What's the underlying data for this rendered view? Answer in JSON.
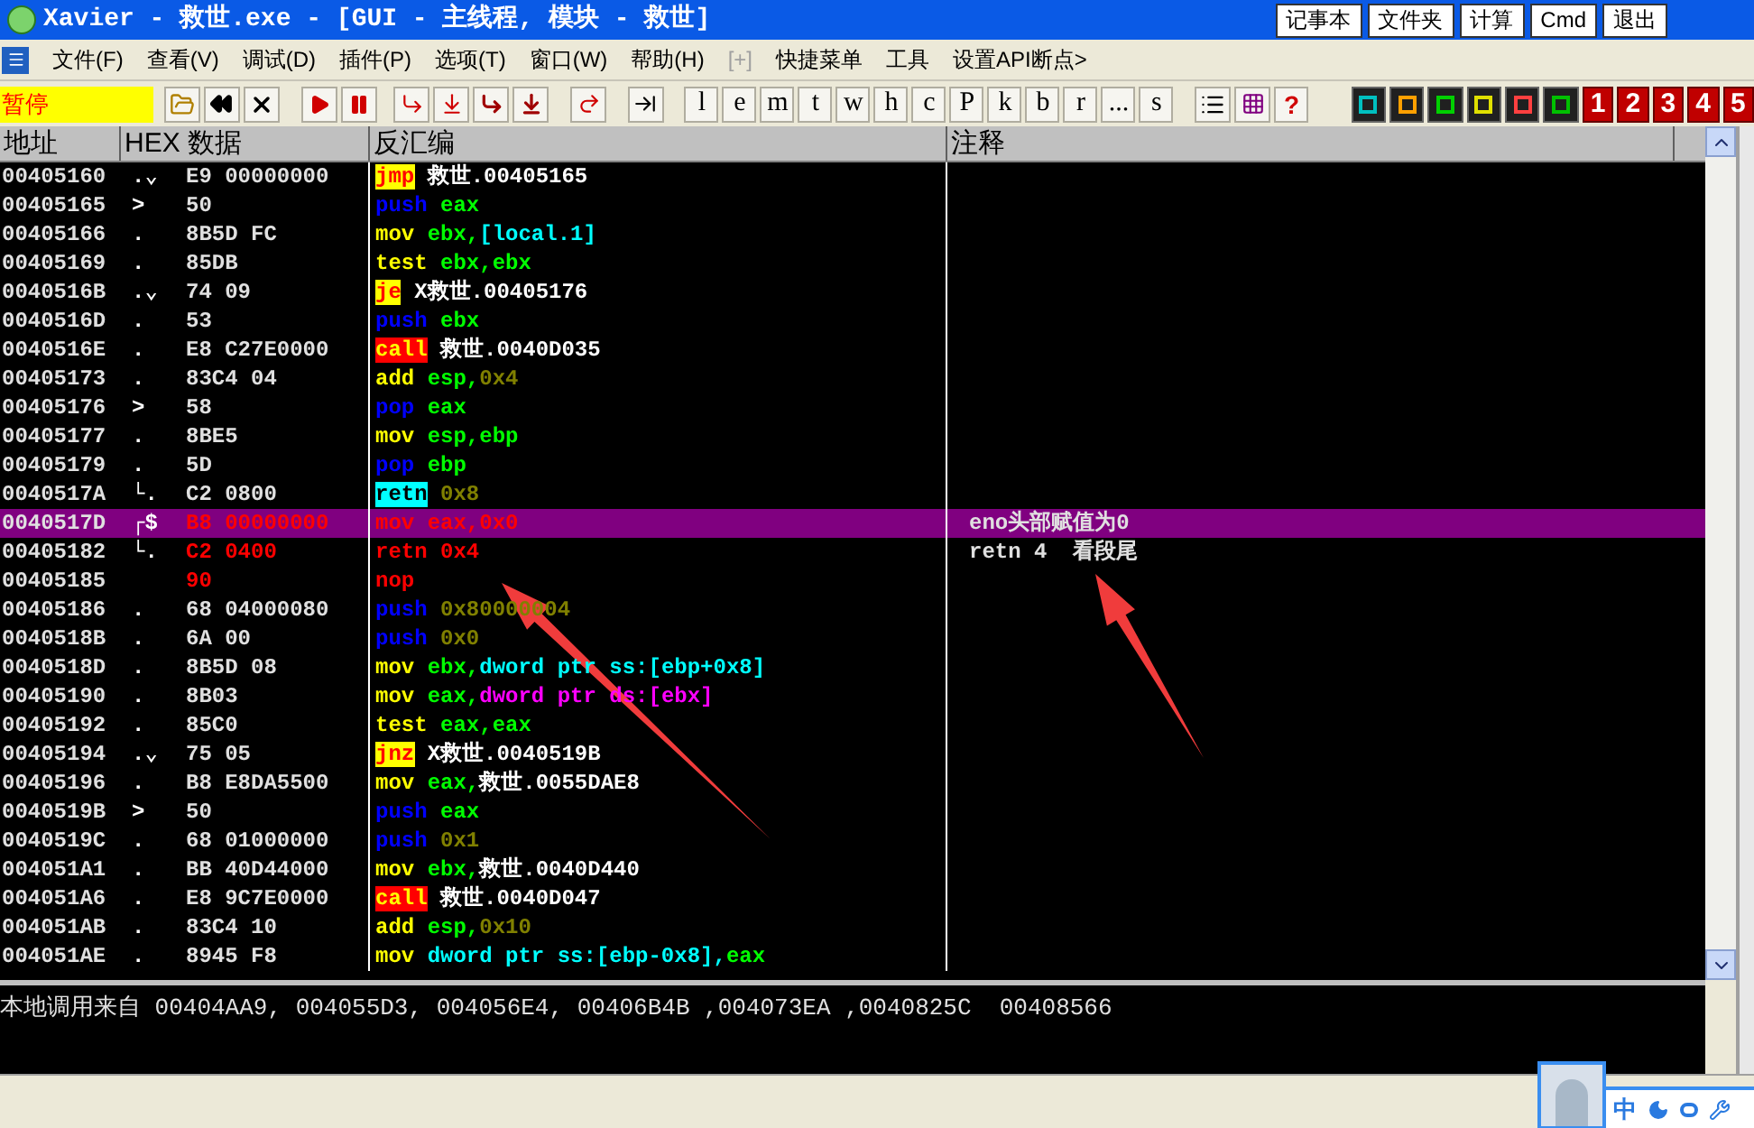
{
  "window": {
    "title": "Xavier - 救世.exe - [GUI -  主线程, 模块 - 救世]"
  },
  "title_buttons": [
    "记事本",
    "文件夹",
    "计算",
    "Cmd",
    "退出"
  ],
  "menu": [
    {
      "label": "文件(F)",
      "disabled": false
    },
    {
      "label": "查看(V)",
      "disabled": false
    },
    {
      "label": "调试(D)",
      "disabled": false
    },
    {
      "label": "插件(P)",
      "disabled": false
    },
    {
      "label": "选项(T)",
      "disabled": false
    },
    {
      "label": "窗口(W)",
      "disabled": false
    },
    {
      "label": "帮助(H)",
      "disabled": false
    },
    {
      "label": "[+]",
      "disabled": true
    },
    {
      "label": "快捷菜单",
      "disabled": false
    },
    {
      "label": "工具",
      "disabled": false
    },
    {
      "label": "设置API断点>",
      "disabled": false
    }
  ],
  "status": "暂停",
  "letter_buttons": [
    "l",
    "e",
    "m",
    "t",
    "w",
    "h",
    "c",
    "P",
    "k",
    "b",
    "r",
    "...",
    "s"
  ],
  "help_button": "?",
  "number_buttons": [
    "1",
    "2",
    "3",
    "4",
    "5"
  ],
  "columns": [
    "地址",
    "HEX 数据",
    "反汇编",
    "注释"
  ],
  "rows": [
    {
      "address": "00405160",
      "flow": ".⌄",
      "hex": "E9 00000000",
      "disasm": [
        {
          "text": "jmp",
          "kind": "jump"
        },
        {
          "text": "救世.00405165",
          "kind": "label"
        }
      ],
      "selected": false,
      "modified": false
    },
    {
      "address": "00405165",
      "flow": ">",
      "hex": "50",
      "disasm": [
        {
          "text": "push",
          "kind": "push"
        },
        {
          "text": "eax",
          "kind": "reg"
        }
      ],
      "selected": false,
      "modified": false
    },
    {
      "address": "00405166",
      "flow": ".",
      "hex": "8B5D FC",
      "disasm": [
        {
          "text": "mov",
          "kind": "op"
        },
        {
          "text": "ebx,",
          "kind": "reg"
        },
        {
          "text": "[local.1]",
          "kind": "mem"
        }
      ],
      "selected": false,
      "modified": false
    },
    {
      "address": "00405169",
      "flow": ".",
      "hex": "85DB",
      "disasm": [
        {
          "text": "test",
          "kind": "op"
        },
        {
          "text": "ebx,ebx",
          "kind": "reg"
        }
      ],
      "selected": false,
      "modified": false
    },
    {
      "address": "0040516B",
      "flow": ".⌄",
      "hex": "74 09",
      "disasm": [
        {
          "text": "je",
          "kind": "jump"
        },
        {
          "text": "X救世.00405176",
          "kind": "label"
        }
      ],
      "selected": false,
      "modified": false
    },
    {
      "address": "0040516D",
      "flow": ".",
      "hex": "53",
      "disasm": [
        {
          "text": "push",
          "kind": "push"
        },
        {
          "text": "ebx",
          "kind": "reg"
        }
      ],
      "selected": false,
      "modified": false
    },
    {
      "address": "0040516E",
      "flow": ".",
      "hex": "E8 C27E0000",
      "disasm": [
        {
          "text": "call",
          "kind": "call"
        },
        {
          "text": "救世.0040D035",
          "kind": "label"
        }
      ],
      "selected": false,
      "modified": false
    },
    {
      "address": "00405173",
      "flow": ".",
      "hex": "83C4 04",
      "disasm": [
        {
          "text": "add",
          "kind": "op"
        },
        {
          "text": "esp,",
          "kind": "reg"
        },
        {
          "text": "0x4",
          "kind": "const"
        }
      ],
      "selected": false,
      "modified": false
    },
    {
      "address": "00405176",
      "flow": ">",
      "hex": "58",
      "disasm": [
        {
          "text": "pop",
          "kind": "push"
        },
        {
          "text": "eax",
          "kind": "reg"
        }
      ],
      "selected": false,
      "modified": false
    },
    {
      "address": "00405177",
      "flow": ".",
      "hex": "8BE5",
      "disasm": [
        {
          "text": "mov",
          "kind": "op"
        },
        {
          "text": "esp,ebp",
          "kind": "reg"
        }
      ],
      "selected": false,
      "modified": false
    },
    {
      "address": "00405179",
      "flow": ".",
      "hex": "5D",
      "disasm": [
        {
          "text": "pop",
          "kind": "push"
        },
        {
          "text": "ebp",
          "kind": "reg"
        }
      ],
      "selected": false,
      "modified": false
    },
    {
      "address": "0040517A",
      "flow": "└.",
      "hex": "C2 0800",
      "disasm": [
        {
          "text": "retn",
          "kind": "ret"
        },
        {
          "text": "0x8",
          "kind": "const"
        }
      ],
      "selected": false,
      "modified": false
    },
    {
      "address": "0040517D",
      "flow": "┌$",
      "hex": "B8 00000000",
      "disasm": [
        {
          "text": "mov",
          "kind": "changed"
        },
        {
          "text": "eax,0x0",
          "kind": "changed"
        }
      ],
      "comment": "eno头部赋值为0",
      "selected": true,
      "modified": true
    },
    {
      "address": "00405182",
      "flow": "└.",
      "hex": "C2 0400",
      "disasm": [
        {
          "text": "retn",
          "kind": "changed"
        },
        {
          "text": "0x4",
          "kind": "changed"
        }
      ],
      "comment": "retn 4  看段尾",
      "selected": false,
      "modified": true
    },
    {
      "address": "00405185",
      "flow": "",
      "hex": "90",
      "disasm": [
        {
          "text": "nop",
          "kind": "changed"
        }
      ],
      "selected": false,
      "modified": true
    },
    {
      "address": "00405186",
      "flow": ".",
      "hex": "68 04000080",
      "disasm": [
        {
          "text": "push",
          "kind": "push"
        },
        {
          "text": "0x80000004",
          "kind": "const"
        }
      ],
      "selected": false,
      "modified": false
    },
    {
      "address": "0040518B",
      "flow": ".",
      "hex": "6A 00",
      "disasm": [
        {
          "text": "push",
          "kind": "push"
        },
        {
          "text": "0x0",
          "kind": "const"
        }
      ],
      "selected": false,
      "modified": false
    },
    {
      "address": "0040518D",
      "flow": ".",
      "hex": "8B5D 08",
      "disasm": [
        {
          "text": "mov",
          "kind": "op"
        },
        {
          "text": "ebx,",
          "kind": "reg"
        },
        {
          "text": "dword ptr ss:[ebp+0x8]",
          "kind": "mem"
        }
      ],
      "selected": false,
      "modified": false
    },
    {
      "address": "00405190",
      "flow": ".",
      "hex": "8B03",
      "disasm": [
        {
          "text": "mov",
          "kind": "op"
        },
        {
          "text": "eax,",
          "kind": "reg"
        },
        {
          "text": "dword ptr ds:[ebx]",
          "kind": "mem2"
        }
      ],
      "selected": false,
      "modified": false
    },
    {
      "address": "00405192",
      "flow": ".",
      "hex": "85C0",
      "disasm": [
        {
          "text": "test",
          "kind": "op"
        },
        {
          "text": "eax,eax",
          "kind": "reg"
        }
      ],
      "selected": false,
      "modified": false
    },
    {
      "address": "00405194",
      "flow": ".⌄",
      "hex": "75 05",
      "disasm": [
        {
          "text": "jnz",
          "kind": "jump"
        },
        {
          "text": "X救世.0040519B",
          "kind": "label"
        }
      ],
      "selected": false,
      "modified": false
    },
    {
      "address": "00405196",
      "flow": ".",
      "hex": "B8 E8DA5500",
      "disasm": [
        {
          "text": "mov",
          "kind": "op"
        },
        {
          "text": "eax,",
          "kind": "reg"
        },
        {
          "text": "救世.0055DAE8",
          "kind": "label"
        }
      ],
      "selected": false,
      "modified": false
    },
    {
      "address": "0040519B",
      "flow": ">",
      "hex": "50",
      "disasm": [
        {
          "text": "push",
          "kind": "push"
        },
        {
          "text": "eax",
          "kind": "reg"
        }
      ],
      "selected": false,
      "modified": false
    },
    {
      "address": "0040519C",
      "flow": ".",
      "hex": "68 01000000",
      "disasm": [
        {
          "text": "push",
          "kind": "push"
        },
        {
          "text": "0x1",
          "kind": "const"
        }
      ],
      "selected": false,
      "modified": false
    },
    {
      "address": "004051A1",
      "flow": ".",
      "hex": "BB 40D44000",
      "disasm": [
        {
          "text": "mov",
          "kind": "op"
        },
        {
          "text": "ebx,",
          "kind": "reg"
        },
        {
          "text": "救世.0040D440",
          "kind": "label"
        }
      ],
      "selected": false,
      "modified": false
    },
    {
      "address": "004051A6",
      "flow": ".",
      "hex": "E8 9C7E0000",
      "disasm": [
        {
          "text": "call",
          "kind": "call"
        },
        {
          "text": "救世.0040D047",
          "kind": "label"
        }
      ],
      "selected": false,
      "modified": false
    },
    {
      "address": "004051AB",
      "flow": ".",
      "hex": "83C4 10",
      "disasm": [
        {
          "text": "add",
          "kind": "op"
        },
        {
          "text": "esp,",
          "kind": "reg"
        },
        {
          "text": "0x10",
          "kind": "const"
        }
      ],
      "selected": false,
      "modified": false
    },
    {
      "address": "004051AE",
      "flow": ".",
      "hex": "8945 F8",
      "disasm": [
        {
          "text": "mov",
          "kind": "op"
        },
        {
          "text": "dword ptr ss:[ebp-0x8],",
          "kind": "mem"
        },
        {
          "text": "eax",
          "kind": "reg"
        }
      ],
      "selected": false,
      "modified": false
    }
  ],
  "info": "本地调用来自 00404AA9, 004055D3, 004056E4, 00406B4B ,004073EA ,0040825C  00408566",
  "ime": "中"
}
